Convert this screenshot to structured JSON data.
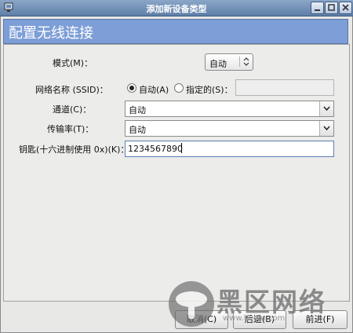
{
  "window": {
    "title": "添加新设备类型"
  },
  "header": {
    "title": "配置无线连接"
  },
  "form": {
    "mode_label": "模式(M)：",
    "mode_value": "自动",
    "ssid_label": "网络名称 (SSID)：",
    "ssid_auto": "自动(A)",
    "ssid_specified": "指定的(S)：",
    "ssid_value": "",
    "channel_label": "通道(C)：",
    "channel_value": "自动",
    "rate_label": "传输率(T)：",
    "rate_value": "自动",
    "key_label": "钥匙(十六进制使用 0x)(K)：",
    "key_value": "1234567890"
  },
  "buttons": {
    "cancel": "取消(C)",
    "back": "后退(B)",
    "forward": "前进(F)"
  },
  "watermark": {
    "text": "黑区网络",
    "url": "www.heiqu.com"
  }
}
